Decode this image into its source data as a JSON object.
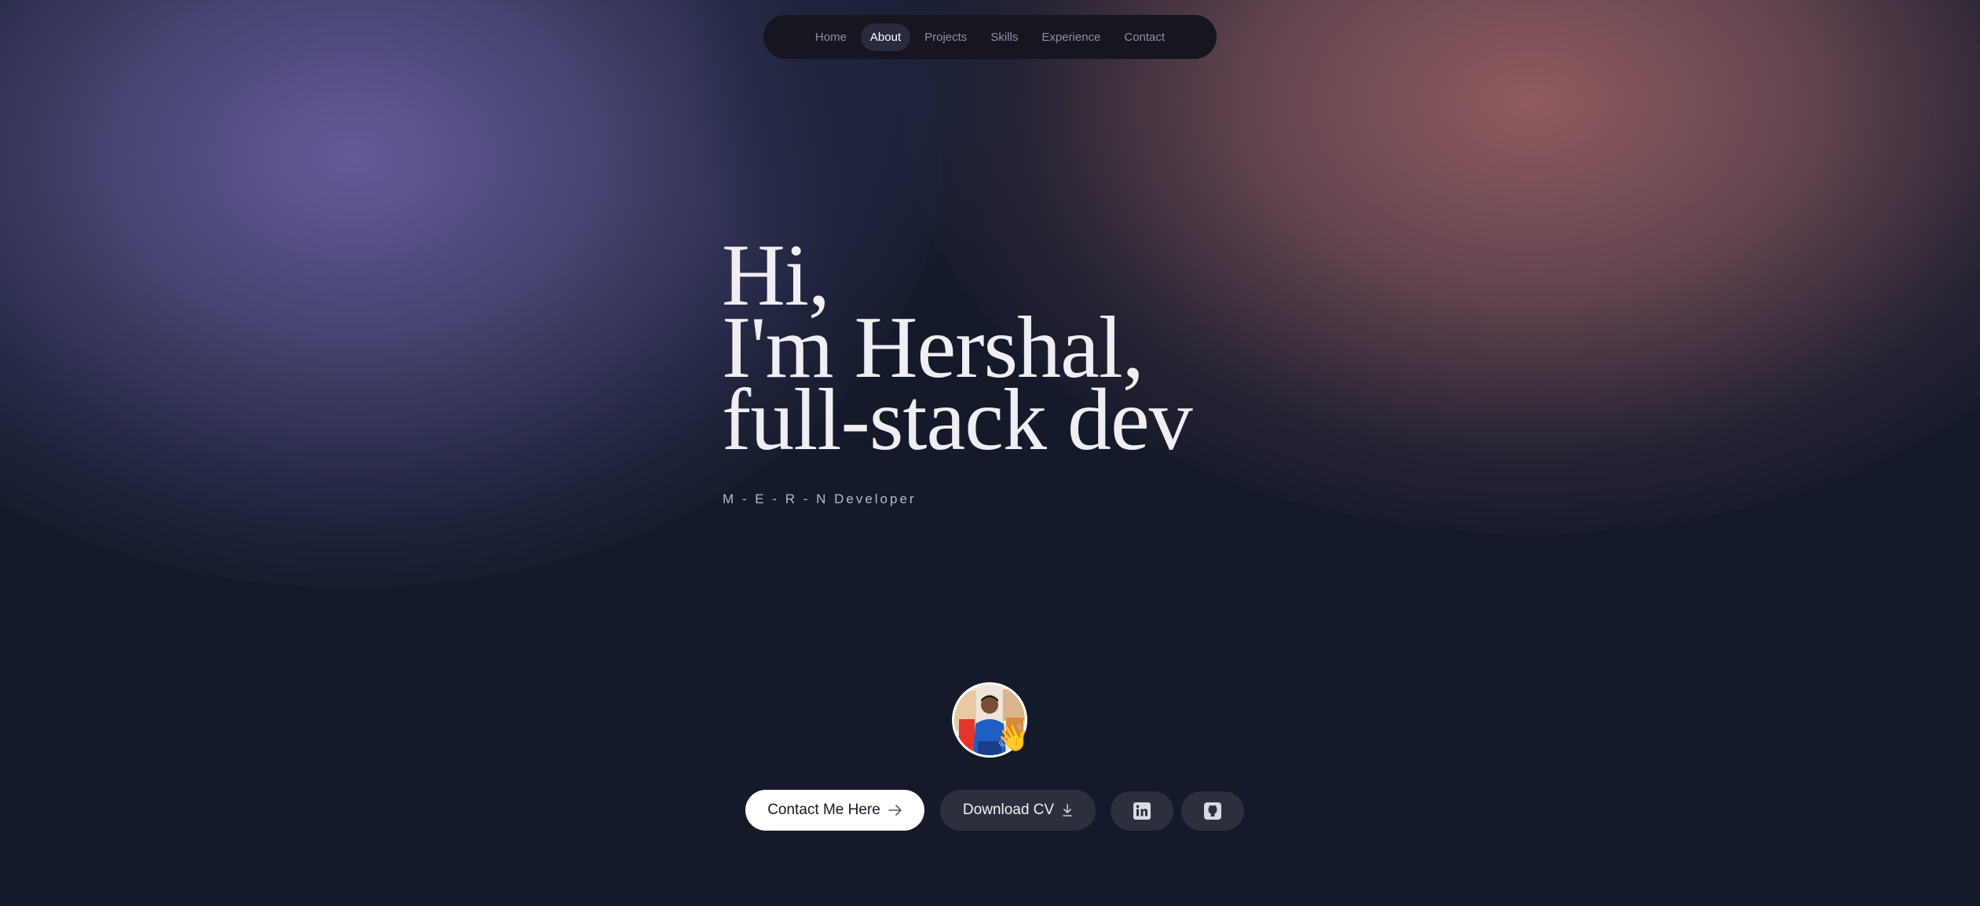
{
  "nav": {
    "items": [
      {
        "label": "Home"
      },
      {
        "label": "About"
      },
      {
        "label": "Projects"
      },
      {
        "label": "Skills"
      },
      {
        "label": "Experience"
      },
      {
        "label": "Contact"
      }
    ],
    "active": "About"
  },
  "hero": {
    "line1": "Hi,",
    "line2": "I'm Hershal,",
    "line3": "full-stack dev",
    "subtitle": "M - E - R - N Developer"
  },
  "avatar": {
    "icon": "avatar-photo",
    "emoji": "👋"
  },
  "actions": {
    "contact_label": "Contact Me Here",
    "contact_icon": "arrow-right-icon",
    "cv_label": "Download CV",
    "cv_icon": "download-icon",
    "linkedin_icon": "linkedin-icon",
    "github_icon": "github-icon"
  },
  "colors": {
    "background": "#141a2a",
    "nav_background": "#15161f",
    "nav_active": "#272b3b",
    "button_primary": "#ffffff",
    "button_secondary": "#2c303d",
    "glow_left": "#685ea0",
    "glow_right": "#965e60"
  }
}
